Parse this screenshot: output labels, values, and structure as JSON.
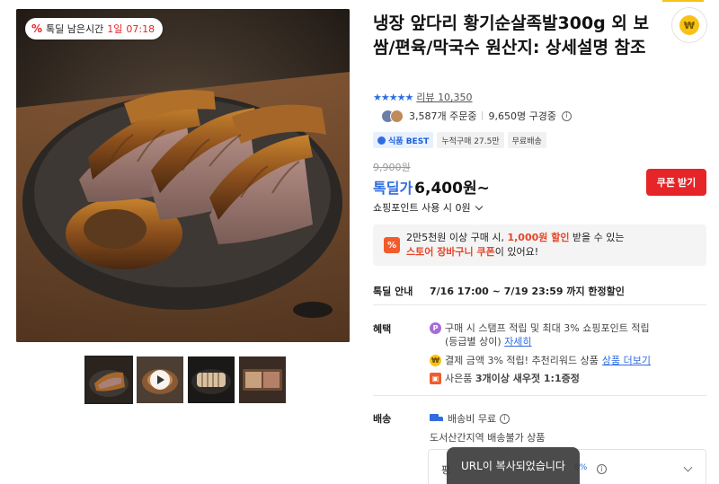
{
  "product": {
    "title": "냉장 앞다리 황기순살족발300g 외 보쌈/편육/막국수 원산지: 상세설명 참조",
    "timer": {
      "prefix": "톡딜 남은시간",
      "highlight": "1일",
      "time": "07:18"
    },
    "rating": {
      "stars": "★★★★★",
      "review_label": "리뷰",
      "review_count": "10,350"
    },
    "stats": {
      "orders": "3,587개 주문중",
      "followers": "9,650명 구경중"
    },
    "tags": [
      "식품 BEST",
      "누적구매 27.5만",
      "무료배송"
    ],
    "original_price": "9,900원",
    "price_label": "톡딜가",
    "price": "6,400원~",
    "coupon_button": "쿠폰 받기",
    "points_label": "쇼핑포인트 사용 시 0원",
    "wish_icon": "won-coin-icon"
  },
  "promo": {
    "icon": "%",
    "line1_pre": "2만5천원 이상 구매 시, ",
    "line1_red": "1,000원 할인",
    "line1_post": " 받을 수 있는",
    "line2_red": "스토어 장바구니 쿠폰",
    "line2_post": "이 있어요!"
  },
  "deal": {
    "label": "톡딜 안내",
    "text": "7/16 17:00 ~ 7/19 23:59 까지 한정할인"
  },
  "benefits": {
    "label": "혜택",
    "items": [
      {
        "icon": "P",
        "line1": "구매 시 스탬프 적립 및 최대 3% 쇼핑포인트 적립",
        "line2": "(등급별 상이)",
        "link": "자세히"
      },
      {
        "icon": "₩",
        "text": "결제 금액 3% 적립! 추천리워드 상품",
        "link": "상품 더보기"
      },
      {
        "icon": "gift",
        "pre": "사은품 ",
        "bold": "3개이상 새우젓 1:1증정"
      }
    ]
  },
  "shipping": {
    "label": "배송",
    "fee": "배송비 무료",
    "note": "도서산간지역 배송불가 상품",
    "box_lead": "평",
    "box_pct": "6%"
  },
  "toast": "URL이 복사되었습니다",
  "colors": {
    "accent_blue": "#2f6ce0",
    "accent_red": "#e52528",
    "promo_orange": "#f25c2a"
  }
}
